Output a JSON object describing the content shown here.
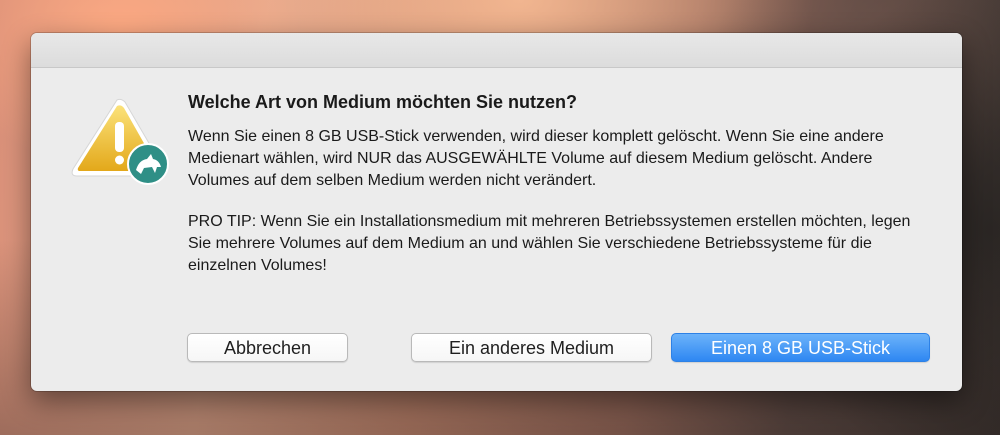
{
  "dialog": {
    "title": "Welche Art von Medium möchten Sie nutzen?",
    "paragraph_1": "Wenn Sie einen 8 GB USB-Stick verwenden, wird dieser komplett gelöscht. Wenn Sie eine andere Medienart wählen, wird NUR das AUSGEWÄHLTE Volume auf diesem Medium gelöscht. Andere Volumes auf dem selben Medium werden nicht verändert.",
    "paragraph_2": "PRO TIP: Wenn Sie ein Installationsmedium mit mehreren Betriebssystemen erstellen möchten, legen Sie mehrere Volumes auf dem Medium an und wählen Sie verschiedene Betriebssysteme für die einzelnen Volumes!",
    "icon": "warning-icon",
    "badge_icon": "app-badge-icon"
  },
  "buttons": {
    "cancel_label": "Abbrechen",
    "other_medium_label": "Ein anderes Medium",
    "usb_stick_label": "Einen 8 GB USB-Stick"
  },
  "colors": {
    "dialog_bg": "#ececec",
    "default_button": "#2e87f2",
    "warning_yellow": "#f2c12e",
    "badge_teal": "#2f8f86"
  }
}
